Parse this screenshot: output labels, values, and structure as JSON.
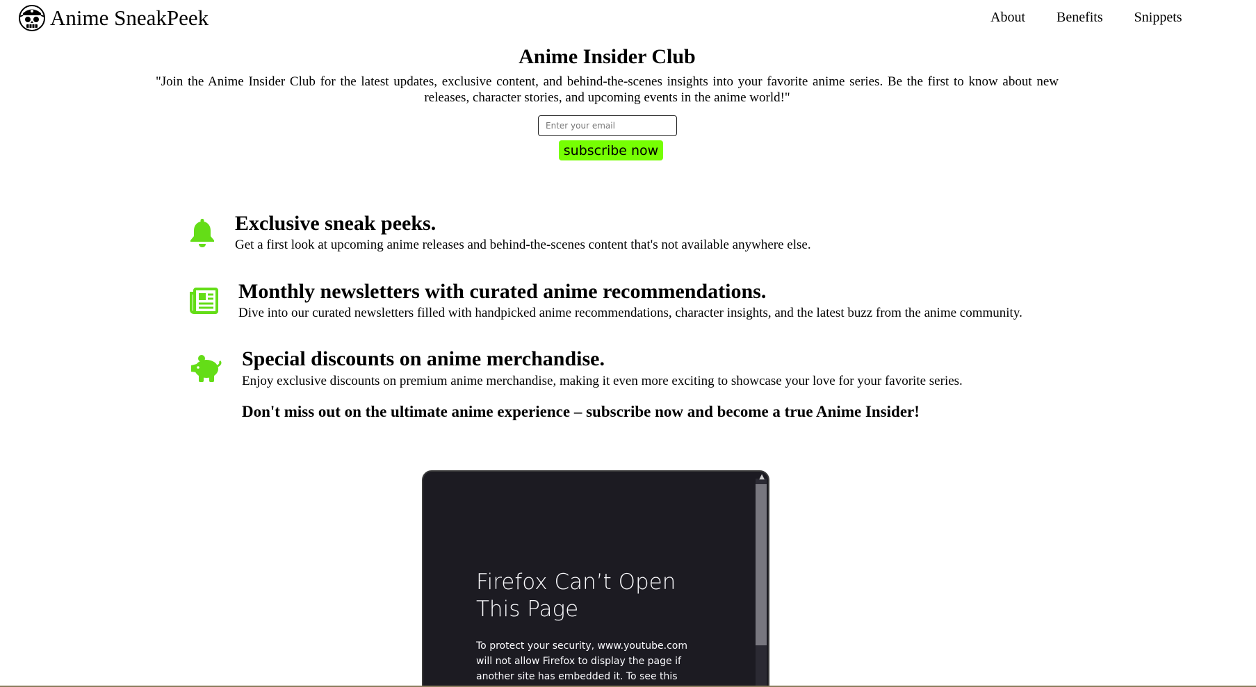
{
  "header": {
    "brand": "Anime SneakPeek",
    "logo_icon": "pirate-skull-icon",
    "nav": [
      "About",
      "Benefits",
      "Snippets"
    ]
  },
  "hero": {
    "title": "Anime Insider Club",
    "text": "\"Join the Anime Insider Club for the latest updates, exclusive content, and behind-the-scenes insights into your favorite anime series. Be the first to know about new releases, character stories, and upcoming events in the anime world!\"",
    "email_placeholder": "Enter your email",
    "subscribe_label": "subscribe now"
  },
  "features": [
    {
      "icon": "bell-icon",
      "title": "Exclusive sneak peeks.",
      "desc": "Get a first look at upcoming anime releases and behind-the-scenes content that's not available anywhere else."
    },
    {
      "icon": "newspaper-icon",
      "title": "Monthly newsletters with curated anime recommendations.",
      "desc": "Dive into our curated newsletters filled with handpicked anime recommendations, character insights, and the latest buzz from the anime community."
    },
    {
      "icon": "piggy-bank-icon",
      "title": "Special discounts on anime merchandise.",
      "desc": "Enjoy exclusive discounts on premium anime merchandise, making it even more exciting to showcase your love for your favorite series."
    }
  ],
  "cta": "Don't miss out on the ultimate anime experience – subscribe now and become a true Anime Insider!",
  "embed": {
    "error_title": "Firefox Can’t Open This Page",
    "error_text": "To protect your security, www.youtube.com will not allow Firefox to display the page if another site has embedded it. To see this page, you need"
  },
  "colors": {
    "accent": "#76ff03",
    "icon_green": "#64dd17",
    "frame_bg": "#1c1b22"
  }
}
